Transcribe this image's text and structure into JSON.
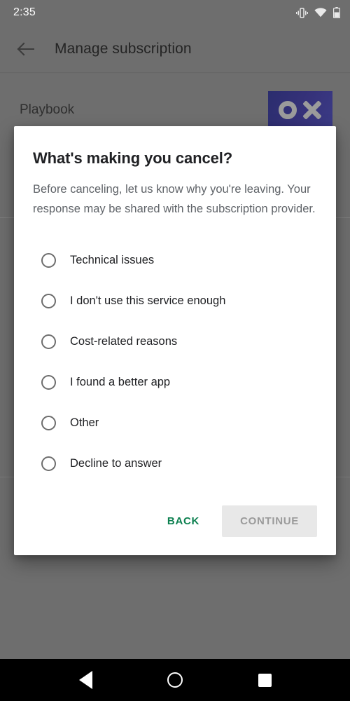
{
  "status_bar": {
    "time": "2:35",
    "icons": [
      "vibrate-icon",
      "wifi-icon",
      "battery-icon"
    ]
  },
  "toolbar": {
    "back_icon": "arrow-back-icon",
    "title": "Manage subscription"
  },
  "app_row": {
    "name": "Playbook",
    "logo_alt": "OX",
    "logo_bg_color": "#36327a",
    "logo_mark_color": "#9b9b9b"
  },
  "dialog": {
    "title": "What's making you cancel?",
    "body": "Before canceling, let us know why you're leaving. Your response may be shared with the subscription provider.",
    "options": [
      {
        "label": "Technical issues",
        "selected": false
      },
      {
        "label": "I don't use this service enough",
        "selected": false
      },
      {
        "label": "Cost-related reasons",
        "selected": false
      },
      {
        "label": "I found a better app",
        "selected": false
      },
      {
        "label": "Other",
        "selected": false
      },
      {
        "label": "Decline to answer",
        "selected": false
      }
    ],
    "actions": {
      "back_label": "BACK",
      "back_color": "#0d8050",
      "continue_label": "CONTINUE",
      "continue_enabled": false,
      "continue_bg_color": "#e8e8e8",
      "continue_text_color": "#9a9a9a"
    }
  },
  "nav_bar": {
    "back_icon": "triangle-back-icon",
    "home_icon": "circle-home-icon",
    "recents_icon": "square-recents-icon"
  }
}
